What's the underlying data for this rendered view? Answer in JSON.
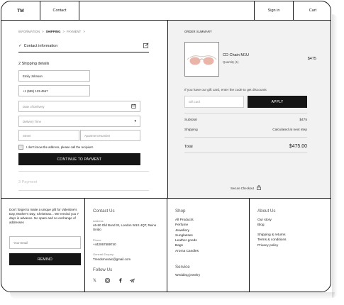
{
  "header": {
    "logo": "TM",
    "nav_contact": "Contact",
    "sign_in": "Sign in",
    "cart": "Cart"
  },
  "breadcrumb": {
    "information": "INFORMATION",
    "shipping": "SHIPPING",
    "payment": "PAYMENT",
    "separator": ">"
  },
  "checkout": {
    "contact_info": "Contact information",
    "shipping_title": "2 Shipping details",
    "name_value": "Emily Johnson",
    "phone_value": "+1 (555) 123-4567",
    "date_placeholder": "Date of Delivery",
    "time_placeholder": "Delivery Time",
    "street_placeholder": "Street",
    "apartment_placeholder": "Apartment Number",
    "dont_know_address": "I don't know the address, please call the recipient.",
    "continue_button": "CONTINUE TO PAYMENT",
    "payments_step": "3 Payment"
  },
  "order_summary": {
    "title": "ORDER SUMMARY",
    "product_name": "CD Chain M1U",
    "product_qty": "Quantity (1)",
    "product_price": "$475",
    "gift_text": "If you have our gift card, enter the code to get discounts",
    "gift_placeholder": "Gift card",
    "apply_button": "APPLY",
    "subtotal_label": "Subtotal",
    "subtotal_value": "$475",
    "shipping_label": "Shipping",
    "shipping_value": "Calculated at next step",
    "total_label": "Total",
    "total_value": "$475.00",
    "secure_checkout": "Secure Checkout"
  },
  "footer": {
    "newsletter_text": "Don't forget to make a unique gift for Valentine's Day, Mother's Day, Christmas... We remind you 7 days in advance. No spam and no exchange of addresses",
    "email_placeholder": "Your Email",
    "remind_button": "REMIND",
    "contact_title": "Contact Us",
    "address_label": "Address",
    "address_value": "46-50 Old Bond St, London W1S 4QT, Reino Unido",
    "phone_label": "Phone",
    "phone_value": "+442067589740",
    "enquiry_label": "General Enquiry:",
    "enquiry_value": "Trendsmosaic@gmail.com",
    "follow_title": "Follow Us",
    "shop_title": "Shop",
    "shop_items": [
      "All Products",
      "Perfume",
      "Jewellery",
      "Sunglasses",
      "Leather goods",
      "Bags",
      "Aroma Candles"
    ],
    "service_title": "Service",
    "service_items": [
      "Wedding jewelry"
    ],
    "about_title": "About Us",
    "about_items": [
      "Our story",
      "Blog"
    ],
    "about_items2": [
      "Shipping & returns",
      "Terms & conditions",
      "Privacy policy"
    ]
  },
  "icons": {
    "edit": "pencil-square-icon",
    "calendar": "calendar-icon",
    "dropdown": "caret-down-icon",
    "lock": "lock-icon",
    "social": [
      "x-icon",
      "instagram-icon",
      "facebook-icon",
      "telegram-icon"
    ]
  }
}
